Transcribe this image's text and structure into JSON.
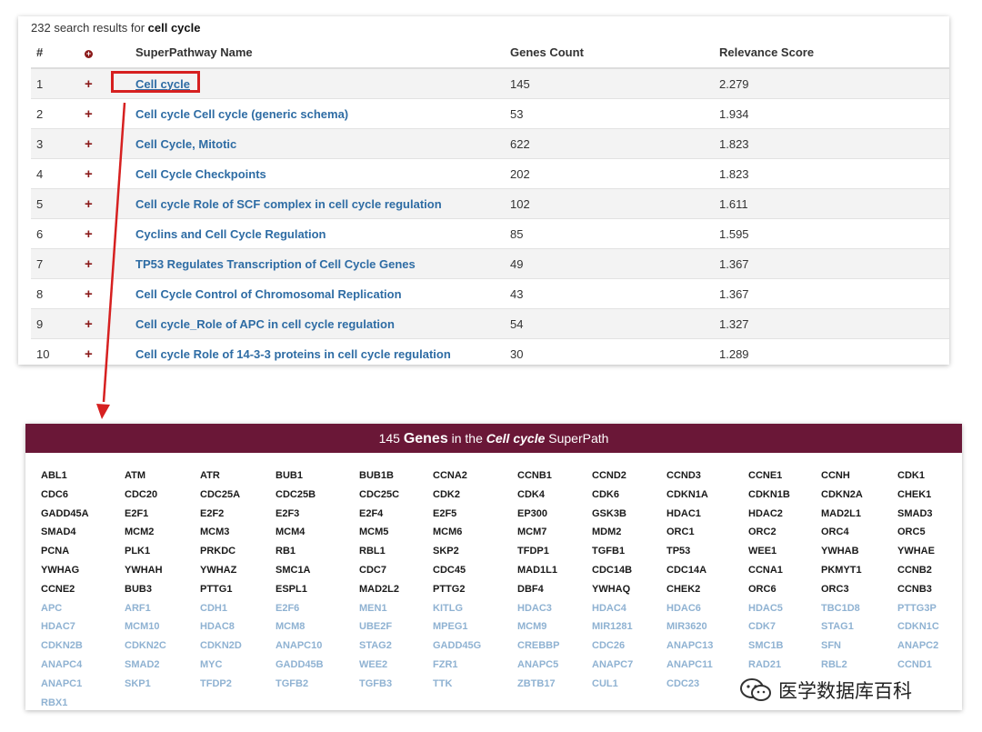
{
  "results": {
    "count": "232",
    "summary_prefix": "search results for",
    "query": "cell cycle",
    "headers": [
      "#",
      "",
      "SuperPathway Name",
      "Genes Count",
      "Relevance Score"
    ],
    "rows": [
      {
        "num": "1",
        "name": "Cell cycle",
        "genes": "145",
        "score": "2.279"
      },
      {
        "num": "2",
        "name": "Cell cycle Cell cycle (generic schema)",
        "genes": "53",
        "score": "1.934"
      },
      {
        "num": "3",
        "name": "Cell Cycle, Mitotic",
        "genes": "622",
        "score": "1.823"
      },
      {
        "num": "4",
        "name": "Cell Cycle Checkpoints",
        "genes": "202",
        "score": "1.823"
      },
      {
        "num": "5",
        "name": "Cell cycle Role of SCF complex in cell cycle regulation",
        "genes": "102",
        "score": "1.611"
      },
      {
        "num": "6",
        "name": "Cyclins and Cell Cycle Regulation",
        "genes": "85",
        "score": "1.595"
      },
      {
        "num": "7",
        "name": "TP53 Regulates Transcription of Cell Cycle Genes",
        "genes": "49",
        "score": "1.367"
      },
      {
        "num": "8",
        "name": "Cell Cycle Control of Chromosomal Replication",
        "genes": "43",
        "score": "1.367"
      },
      {
        "num": "9",
        "name": "Cell cycle_Role of APC in cell cycle regulation",
        "genes": "54",
        "score": "1.327"
      },
      {
        "num": "10",
        "name": "Cell cycle Role of 14-3-3 proteins in cell cycle regulation",
        "genes": "30",
        "score": "1.289"
      }
    ]
  },
  "genes_panel": {
    "count": "145",
    "genes_word": "Genes",
    "in_the": "in the",
    "pathway": "Cell cycle",
    "superpath": "SuperPath",
    "header_color": "#6a1737",
    "dark_genes": [
      "ABL1",
      "ATM",
      "ATR",
      "BUB1",
      "BUB1B",
      "CCNA2",
      "CCNB1",
      "CCND2",
      "CCND3",
      "CCNE1",
      "CCNH",
      "CDK1",
      "CDC6",
      "CDC20",
      "CDC25A",
      "CDC25B",
      "CDC25C",
      "CDK2",
      "CDK4",
      "CDK6",
      "CDKN1A",
      "CDKN1B",
      "CDKN2A",
      "CHEK1",
      "GADD45A",
      "E2F1",
      "E2F2",
      "E2F3",
      "E2F4",
      "E2F5",
      "EP300",
      "GSK3B",
      "HDAC1",
      "HDAC2",
      "MAD2L1",
      "SMAD3",
      "SMAD4",
      "MCM2",
      "MCM3",
      "MCM4",
      "MCM5",
      "MCM6",
      "MCM7",
      "MDM2",
      "ORC1",
      "ORC2",
      "ORC4",
      "ORC5",
      "PCNA",
      "PLK1",
      "PRKDC",
      "RB1",
      "RBL1",
      "SKP2",
      "TFDP1",
      "TGFB1",
      "TP53",
      "WEE1",
      "YWHAB",
      "YWHAE",
      "YWHAG",
      "YWHAH",
      "YWHAZ",
      "SMC1A",
      "CDC7",
      "CDC45",
      "MAD1L1",
      "CDC14B",
      "CDC14A",
      "CCNA1",
      "PKMYT1",
      "CCNB2",
      "CCNE2",
      "BUB3",
      "PTTG1",
      "ESPL1",
      "MAD2L2",
      "PTTG2",
      "DBF4",
      "YWHAQ",
      "CHEK2",
      "ORC6",
      "ORC3",
      "CCNB3"
    ],
    "light_genes": [
      "APC",
      "ARF1",
      "CDH1",
      "E2F6",
      "MEN1",
      "KITLG",
      "HDAC3",
      "HDAC4",
      "HDAC6",
      "HDAC5",
      "TBC1D8",
      "PTTG3P",
      "HDAC7",
      "MCM10",
      "HDAC8",
      "MCM8",
      "UBE2F",
      "MPEG1",
      "MCM9",
      "MIR1281",
      "MIR3620",
      "CDK7",
      "STAG1",
      "CDKN1C",
      "CDKN2B",
      "CDKN2C",
      "CDKN2D",
      "ANAPC10",
      "STAG2",
      "GADD45G",
      "CREBBP",
      "CDC26",
      "ANAPC13",
      "SMC1B",
      "SFN",
      "ANAPC2",
      "ANAPC4",
      "SMAD2",
      "MYC",
      "GADD45B",
      "WEE2",
      "FZR1",
      "ANAPC5",
      "ANAPC7",
      "ANAPC11",
      "RAD21",
      "RBL2",
      "CCND1",
      "ANAPC1",
      "SKP1",
      "TFDP2",
      "TGFB2",
      "TGFB3",
      "TTK",
      "ZBTB17",
      "CUL1",
      "CDC23",
      "",
      "",
      "",
      "RBX1"
    ]
  },
  "watermark": {
    "text": "医学数据库百科"
  },
  "colors": {
    "link": "#2e6ca4",
    "highlight": "#d62020",
    "plus": "#8b1a1a",
    "light_gene": "#8fb2d2"
  }
}
